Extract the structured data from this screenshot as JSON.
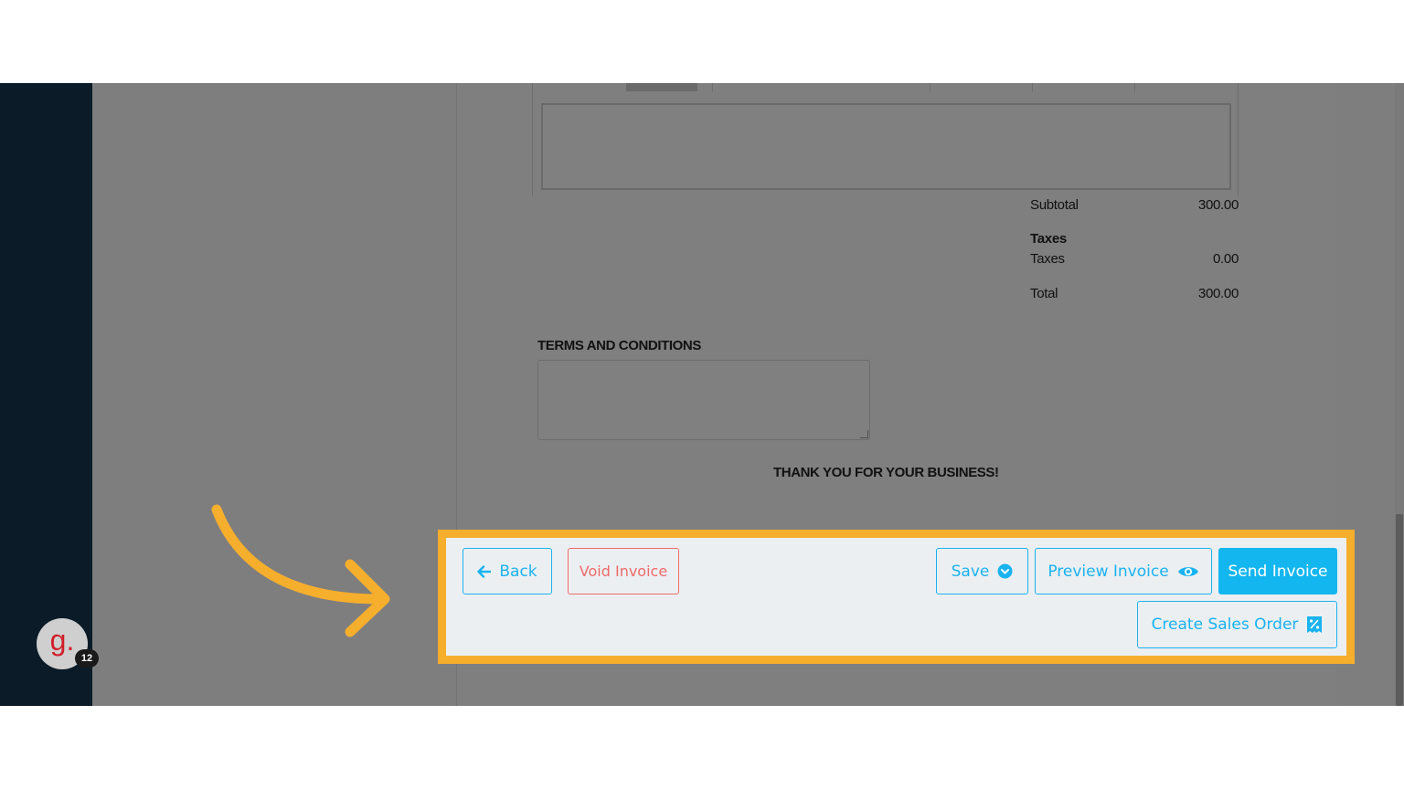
{
  "summary": {
    "subtotal_label": "Subtotal",
    "subtotal_value": "300.00",
    "taxes_heading": "Taxes",
    "taxes_label": "Taxes",
    "taxes_value": "0.00",
    "total_label": "Total",
    "total_value": "300.00"
  },
  "terms": {
    "title": "TERMS AND CONDITIONS",
    "value": ""
  },
  "footer_message": "THANK YOU FOR YOUR BUSINESS!",
  "avatar": {
    "letter": "g.",
    "badge_count": "12"
  },
  "actions": {
    "back_label": "Back",
    "void_label": "Void Invoice",
    "save_label": "Save",
    "preview_label": "Preview Invoice",
    "send_label": "Send Invoice",
    "create_sales_order_label": "Create Sales Order"
  },
  "icons": {
    "back": "arrow-left-icon",
    "save": "chevron-down-circle-icon",
    "preview": "eye-icon",
    "create_sales_order": "receipt-percent-icon",
    "annotation": "curved-arrow-icon"
  },
  "colors": {
    "accent": "#19b3f0",
    "danger": "#ef6a6a",
    "highlight": "#f6ae2d",
    "sidebar": "#0b1b28"
  }
}
